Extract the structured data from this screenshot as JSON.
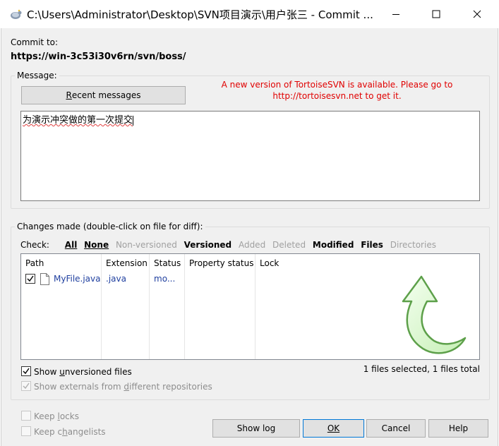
{
  "window": {
    "title": "C:\\Users\\Administrator\\Desktop\\SVN项目演示\\用户张三 - Commit ...",
    "app_icon": "tortoisesvn-icon",
    "controls": [
      "minimize-icon",
      "maximize-icon",
      "close-icon"
    ]
  },
  "commit_to": {
    "label": "Commit to:",
    "url": "https://win-3c53i30v6rn/svn/boss/"
  },
  "message": {
    "legend": "Message:",
    "recent_button": "Recent messages",
    "recent_button_accel": "R",
    "recent_button_rest": "ecent messages",
    "update_notice_line1": "A new version of TortoiseSVN is available. Please go to",
    "update_notice_line2": "http://tortoisesvn.net to get it.",
    "text": "为演示冲突做的第一次提交"
  },
  "changes": {
    "legend": "Changes made (double-click on file for diff):",
    "check_label": "Check:",
    "filters": {
      "all": "All",
      "none": "None",
      "non_versioned": "Non-versioned",
      "versioned": "Versioned",
      "added": "Added",
      "deleted": "Deleted",
      "modified": "Modified",
      "files": "Files",
      "directories": "Directories"
    },
    "columns": {
      "path": "Path",
      "extension": "Extension",
      "status": "Status",
      "property_status": "Property status",
      "lock": "Lock"
    },
    "rows": [
      {
        "checked": true,
        "path": "MyFile.java",
        "extension": ".java",
        "status": "mo..."
      }
    ],
    "summary": "1 files selected, 1 files total"
  },
  "options": {
    "show_unversioned": {
      "pre": "Show ",
      "accel": "u",
      "post": "nversioned files",
      "checked": true
    },
    "show_externals": {
      "pre": "Show externals from ",
      "accel": "d",
      "post": "ifferent repositories",
      "checked": true,
      "disabled": true
    },
    "keep_locks": {
      "pre": "Keep ",
      "accel": "l",
      "post": "ocks",
      "checked": false,
      "disabled": true
    },
    "keep_changelists": {
      "pre": "Keep c",
      "accel": "h",
      "post": "angelists",
      "checked": false,
      "disabled": true
    }
  },
  "buttons": {
    "show_log": "Show log",
    "ok": "OK",
    "cancel": "Cancel",
    "help": "Help"
  },
  "colors": {
    "notice": "#e00000",
    "link_text": "#1f3f9f",
    "accent": "#0078d7"
  }
}
